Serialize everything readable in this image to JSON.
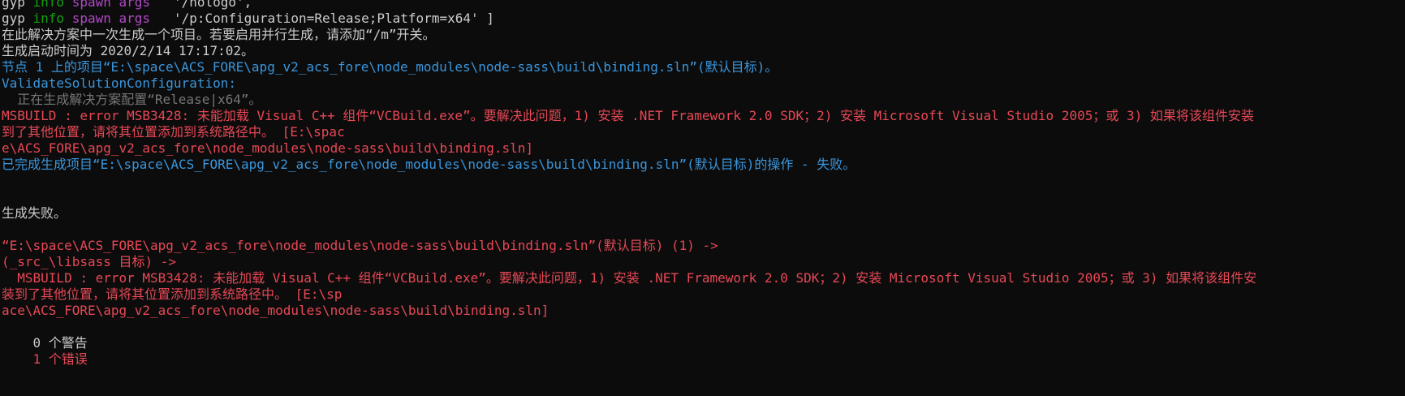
{
  "terminal": {
    "colors": {
      "background": "#0c0c0c",
      "default": "#cccccc",
      "green": "#13a10e",
      "magenta": "#b148c6",
      "cyan": "#3a96dd",
      "red": "#e74856",
      "grey": "#767676"
    },
    "lines": [
      [
        {
          "t": "gyp ",
          "c": "default"
        },
        {
          "t": "info ",
          "c": "green"
        },
        {
          "t": "spawn args",
          "c": "magenta"
        },
        {
          "t": "   '/nologo',",
          "c": "default"
        }
      ],
      [
        {
          "t": "gyp ",
          "c": "default"
        },
        {
          "t": "info ",
          "c": "green"
        },
        {
          "t": "spawn args",
          "c": "magenta"
        },
        {
          "t": "   '/p:Configuration=Release;Platform=x64' ]",
          "c": "default"
        }
      ],
      [
        {
          "t": "在此解决方案中一次生成一个项目。若要启用并行生成，请添加“/m”开关。",
          "c": "default"
        }
      ],
      [
        {
          "t": "生成启动时间为 2020/2/14 17:17:02。",
          "c": "default"
        }
      ],
      [
        {
          "t": "节点 1 上的项目“E:\\space\\ACS_FORE\\apg_v2_acs_fore\\node_modules\\node-sass\\build\\binding.sln”(默认目标)。",
          "c": "cyan"
        }
      ],
      [
        {
          "t": "ValidateSolutionConfiguration:",
          "c": "cyan"
        }
      ],
      [
        {
          "t": "  正在生成解决方案配置“Release|x64”。",
          "c": "grey"
        }
      ],
      [
        {
          "t": "MSBUILD : error MSB3428: 未能加载 Visual C++ 组件“VCBuild.exe”。要解决此问题，1) 安装 .NET Framework 2.0 SDK；2) 安装 Microsoft Visual Studio 2005；或 3) 如果将该组件安装",
          "c": "red"
        }
      ],
      [
        {
          "t": "到了其他位置，请将其位置添加到系统路径中。 [E:\\spac",
          "c": "red"
        }
      ],
      [
        {
          "t": "e\\ACS_FORE\\apg_v2_acs_fore\\node_modules\\node-sass\\build\\binding.sln]",
          "c": "red"
        }
      ],
      [
        {
          "t": "已完成生成项目“E:\\space\\ACS_FORE\\apg_v2_acs_fore\\node_modules\\node-sass\\build\\binding.sln”(默认目标)的操作 - 失败。",
          "c": "cyan"
        }
      ],
      [
        {
          "t": "",
          "c": "default"
        }
      ],
      [
        {
          "t": "",
          "c": "default"
        }
      ],
      [
        {
          "t": "生成失败。",
          "c": "default"
        }
      ],
      [
        {
          "t": "",
          "c": "default"
        }
      ],
      [
        {
          "t": "“E:\\space\\ACS_FORE\\apg_v2_acs_fore\\node_modules\\node-sass\\build\\binding.sln”(默认目标) (1) ->",
          "c": "red"
        }
      ],
      [
        {
          "t": "(_src_\\libsass 目标) ->",
          "c": "red"
        }
      ],
      [
        {
          "t": "  MSBUILD : error MSB3428: 未能加载 Visual C++ 组件“VCBuild.exe”。要解决此问题，1) 安装 .NET Framework 2.0 SDK；2) 安装 Microsoft Visual Studio 2005；或 3) 如果将该组件安",
          "c": "red"
        }
      ],
      [
        {
          "t": "装到了其他位置，请将其位置添加到系统路径中。 [E:\\sp",
          "c": "red"
        }
      ],
      [
        {
          "t": "ace\\ACS_FORE\\apg_v2_acs_fore\\node_modules\\node-sass\\build\\binding.sln]",
          "c": "red"
        }
      ],
      [
        {
          "t": "",
          "c": "default"
        }
      ],
      [
        {
          "t": "    0 个警告",
          "c": "default"
        }
      ],
      [
        {
          "t": "    1 个错误",
          "c": "red"
        }
      ]
    ]
  }
}
